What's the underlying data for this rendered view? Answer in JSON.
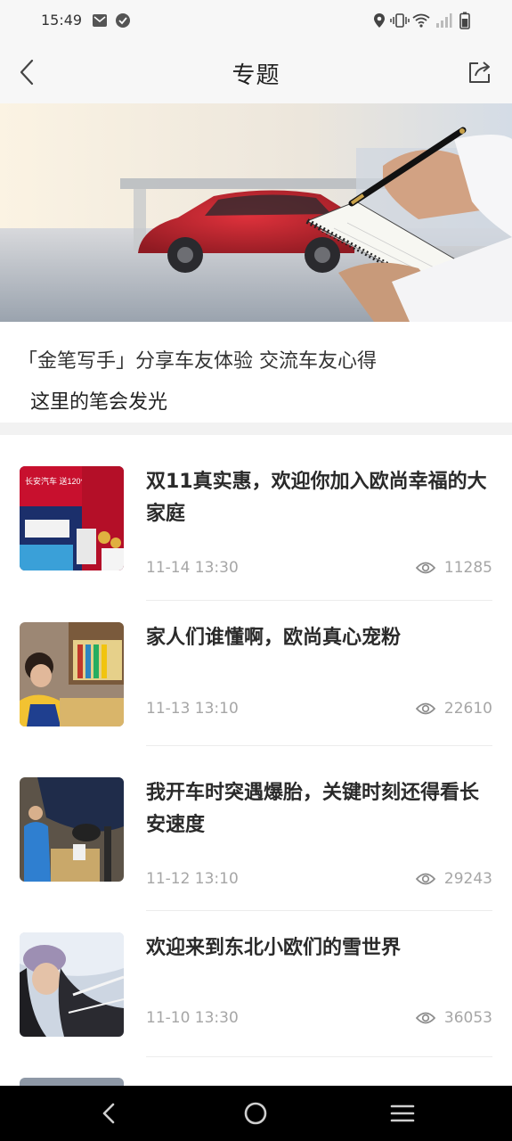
{
  "status": {
    "time": "15:49"
  },
  "header": {
    "title": "专题"
  },
  "intro": {
    "line1": "「金笔写手」分享车友体验 交流车友心得",
    "line2": "这里的笔会发光"
  },
  "articles": [
    {
      "title": "双11真实惠，欢迎你加入欧尚幸福的大家庭",
      "date": "11-14 13:30",
      "views": "11285"
    },
    {
      "title": "家人们谁懂啊，欧尚真心宠粉",
      "date": "11-13 13:10",
      "views": "22610"
    },
    {
      "title": "我开车时突遇爆胎，关键时刻还得看长安速度",
      "date": "11-12 13:10",
      "views": "29243"
    },
    {
      "title": "欢迎来到东北小欧们的雪世界",
      "date": "11-10 13:30",
      "views": "36053"
    }
  ],
  "thumb1": {
    "poster_text": "长安汽车 送120亿 11.11大促开启"
  },
  "colors": {
    "header_bg": "#f7f7f7",
    "meta_gray": "#a6a6a6",
    "title_text": "#2a2a2a",
    "nav_bg": "#000000"
  },
  "icons": {
    "back": "chevron-left-icon",
    "share": "share-icon",
    "views": "eye-icon",
    "nav_back": "triangle-back-icon",
    "nav_home": "circle-home-icon",
    "nav_menu": "menu-lines-icon"
  }
}
